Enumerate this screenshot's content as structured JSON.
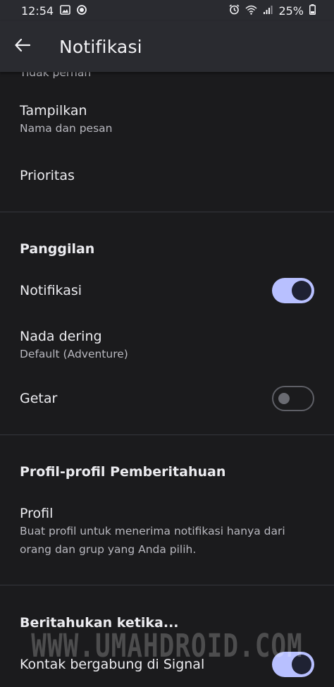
{
  "status_bar": {
    "time": "12:54",
    "left_icons": [
      "image-icon",
      "chat-bubble-icon"
    ],
    "right_icons": [
      "alarm-icon",
      "wifi-icon",
      "signal-icon"
    ],
    "battery": "25%"
  },
  "app_bar": {
    "back_icon": "arrow-left-icon",
    "title": "Notifikasi"
  },
  "messages_section": {
    "partial_value": "Tidak pernah",
    "show": {
      "label": "Tampilkan",
      "value": "Nama dan pesan"
    },
    "priority": {
      "label": "Prioritas"
    }
  },
  "calls_section": {
    "header": "Panggilan",
    "notifications": {
      "label": "Notifikasi",
      "enabled": true
    },
    "ringtone": {
      "label": "Nada dering",
      "value": "Default (Adventure)"
    },
    "vibrate": {
      "label": "Getar",
      "enabled": false
    }
  },
  "profiles_section": {
    "header": "Profil-profil Pemberitahuan",
    "profile": {
      "label": "Profil",
      "desc_line1": "Buat profil untuk menerima notifikasi hanya dari",
      "desc_line2": "orang dan grup yang Anda pilih."
    }
  },
  "notify_section": {
    "header": "Beritahukan ketika...",
    "contact_joined": {
      "label": "Kontak bergabung di Signal",
      "enabled": true
    }
  },
  "watermark": "WWW.UMAHDROID.COM",
  "colors": {
    "background": "#1b1b1d",
    "app_bar": "#2a2b30",
    "toggle_on": "#b8c0ff",
    "toggle_knob_on": "#1f2233",
    "divider": "#35363c"
  }
}
